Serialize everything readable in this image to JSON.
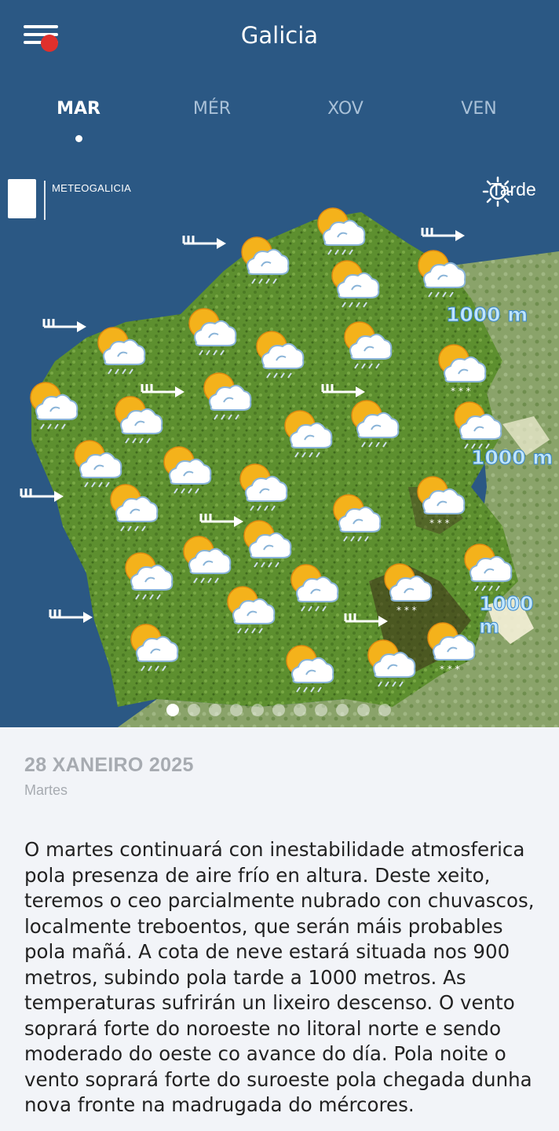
{
  "header": {
    "title": "Galicia",
    "menu_icon": "hamburger-menu-icon",
    "notification_color": "#e0302c"
  },
  "days": [
    {
      "label": "MAR",
      "active": true
    },
    {
      "label": "MÉR",
      "active": false
    },
    {
      "label": "XOV",
      "active": false
    },
    {
      "label": "VEN",
      "active": false
    }
  ],
  "map": {
    "logo_text": "METEOGALICIA",
    "period_icon": "sun-icon",
    "period_label": "Tarde",
    "altitude_labels": [
      "1000 m",
      "1000 m",
      "1000 m"
    ],
    "pages": 11,
    "current_page": 1,
    "icons": {
      "weather": "sun-cloud-rain-icon",
      "weather_snow": "sun-cloud-snow-icon",
      "wind": "wind-arrow-icon"
    }
  },
  "detail": {
    "date": "28 XANEIRO 2025",
    "weekday": "Martes",
    "forecast": "O martes continuará con inestabilidade atmosferica pola presenza de aire frío en altura. Deste xeito, teremos o ceo parcialmente nubrado con chuvascos, localmente treboentos, que serán máis probables pola mañá. A cota de neve estará situada nos 900 metros, subindo pola tarde a 1000 metros. As temperaturas sufrirán un lixeiro descenso.  O vento soprará forte do noroeste no litoral norte e sendo moderado do oeste co avance do día. Pola noite o vento soprará forte do suroeste pola chegada dunha nova fronte na madrugada do mércores."
  },
  "colors": {
    "header_bg": "#2b5884",
    "land_green": "#5f8f2e",
    "content_bg": "#f2f4f8"
  }
}
